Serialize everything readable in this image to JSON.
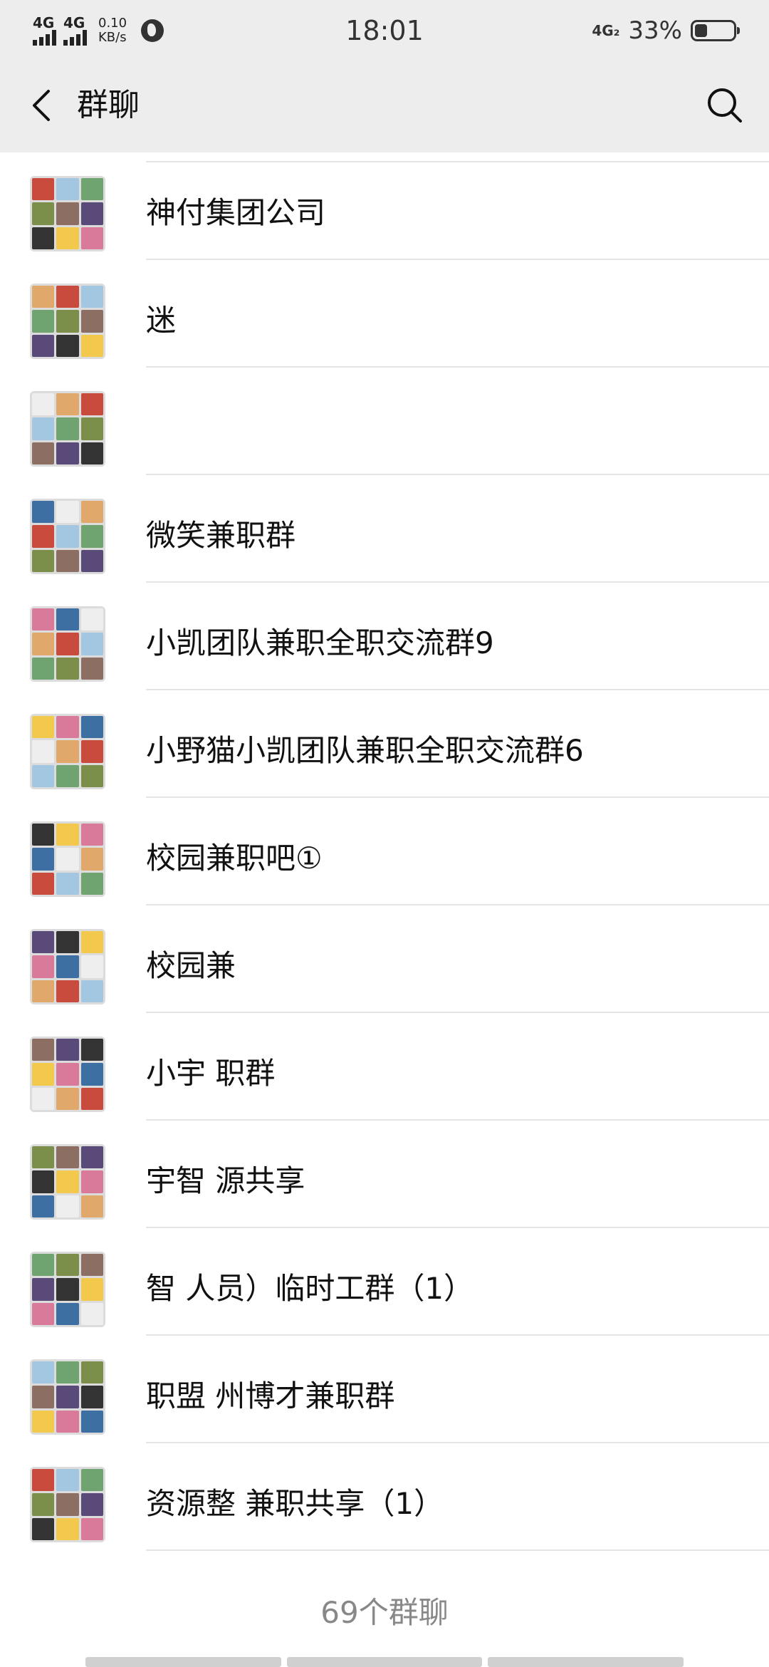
{
  "status_bar": {
    "sim1": "4G",
    "sim2": "4G",
    "speed_value": "0.10",
    "speed_unit": "KB/s",
    "time": "18:01",
    "network": "4G₂",
    "battery": "33%",
    "battery_level": 0.33
  },
  "nav": {
    "title": "群聊",
    "back_icon": "chevron-left-icon",
    "search_icon": "search-icon"
  },
  "groups": [
    {
      "name": "神付集团公司"
    },
    {
      "name": "迷"
    },
    {
      "name": ""
    },
    {
      "name": "微笑兼职群"
    },
    {
      "name": "小凯团队兼职全职交流群9"
    },
    {
      "name": "小野猫小凯团队兼职全职交流群6"
    },
    {
      "name": "校园兼职吧①"
    },
    {
      "name": "校园兼"
    },
    {
      "name": "小宇 职群"
    },
    {
      "name": "宇智 源共享"
    },
    {
      "name": "智 人员）临时工群（1）"
    },
    {
      "name": "职盟 州博才兼职群"
    },
    {
      "name": "资源整 兼职共享（1）"
    }
  ],
  "footer": {
    "count": "69个群聊"
  },
  "colors": {
    "bar_bg": "#ededed",
    "divider": "#e5e5e5",
    "text": "#111111",
    "muted": "#888888"
  }
}
